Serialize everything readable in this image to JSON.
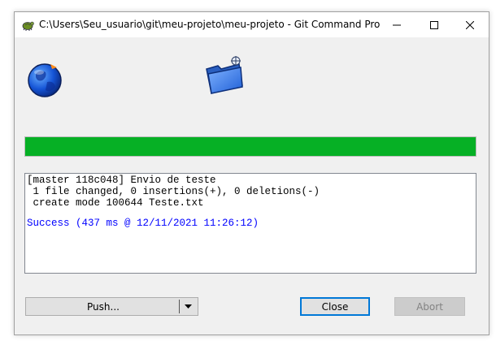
{
  "window": {
    "title": "C:\\Users\\Seu_usuario\\git\\meu-projeto\\meu-projeto - Git Command Progre...",
    "controls": {
      "minimize": "—",
      "maximize": "☐",
      "close": "✕"
    }
  },
  "progress": {
    "value_percent": 100,
    "color": "#06b025"
  },
  "log": {
    "lines": [
      "[master 118c048] Envio de teste",
      " 1 file changed, 0 insertions(+), 0 deletions(-)",
      " create mode 100644 Teste.txt"
    ],
    "success": "Success (437 ms @ 12/11/2021 11:26:12)",
    "success_color": "#0000ff"
  },
  "buttons": {
    "push_label": "Push...",
    "push_dropdown_icon": "chevron-down-icon",
    "close_label": "Close",
    "abort_label": "Abort"
  },
  "icons": {
    "title": "tortoisegit-icon",
    "globe": "globe-icon",
    "folder": "folder-icon"
  }
}
